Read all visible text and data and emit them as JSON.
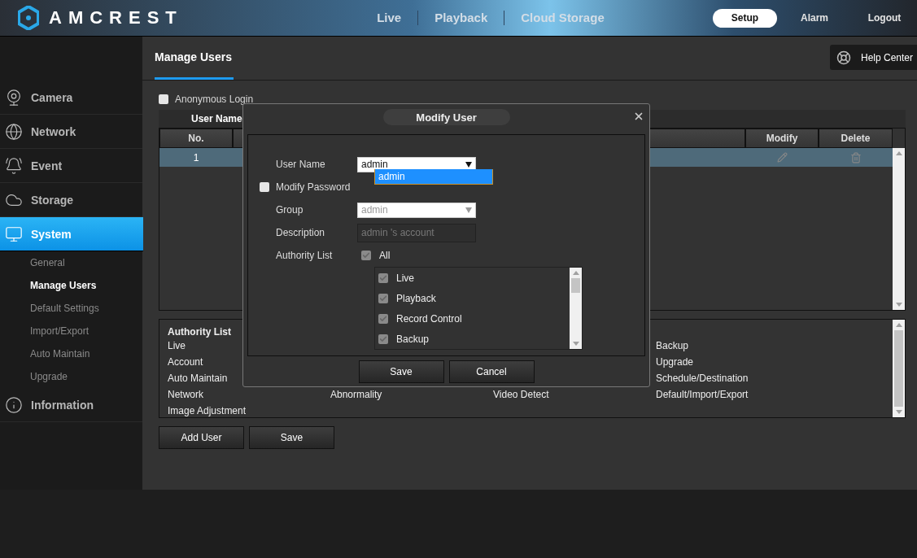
{
  "brand": {
    "name": "AMCREST"
  },
  "top_nav": [
    {
      "label": "Live",
      "selected": false
    },
    {
      "label": "Playback",
      "selected": false
    },
    {
      "label": "Cloud Storage",
      "selected": false
    }
  ],
  "top_actions": [
    {
      "label": "Setup",
      "selected": true
    },
    {
      "label": "Alarm",
      "selected": false
    },
    {
      "label": "Logout",
      "selected": false
    }
  ],
  "sidebar": {
    "items": [
      {
        "label": "Camera",
        "selected": false
      },
      {
        "label": "Network",
        "selected": false
      },
      {
        "label": "Event",
        "selected": false
      },
      {
        "label": "Storage",
        "selected": false
      },
      {
        "label": "System",
        "selected": true,
        "children": [
          {
            "label": "General",
            "selected": false
          },
          {
            "label": "Manage Users",
            "selected": true
          },
          {
            "label": "Default Settings",
            "selected": false
          },
          {
            "label": "Import/Export",
            "selected": false
          },
          {
            "label": "Auto Maintain",
            "selected": false
          },
          {
            "label": "Upgrade",
            "selected": false
          }
        ]
      },
      {
        "label": "Information",
        "selected": false
      }
    ]
  },
  "page": {
    "tab": "Manage Users",
    "help": "Help Center"
  },
  "anonymous_login": {
    "label": "Anonymous Login",
    "checked": false
  },
  "users_table": {
    "title": "User Name",
    "columns": [
      "No.",
      null,
      "Modify",
      "Delete"
    ],
    "rows": [
      {
        "no": "1",
        "selected": true
      }
    ]
  },
  "authority_panel": {
    "title": "Authority List",
    "rows": [
      [
        "Live",
        null,
        null,
        "Backup"
      ],
      [
        "Account",
        null,
        null,
        "Upgrade"
      ],
      [
        "Auto Maintain",
        null,
        null,
        "Schedule/Destination"
      ],
      [
        "Network",
        "Abnormality",
        "Video Detect",
        "Default/Import/Export"
      ],
      [
        "Image Adjustment",
        null,
        null,
        null
      ]
    ]
  },
  "buttons": [
    "Add User",
    "Save"
  ],
  "modal": {
    "title": "Modify User",
    "user_name": {
      "label": "User Name",
      "value": "admin",
      "options": [
        {
          "label": "admin",
          "selected": true
        }
      ]
    },
    "modify_password": {
      "label": "Modify Password",
      "checked": false
    },
    "group": {
      "label": "Group",
      "value": "admin",
      "disabled": true
    },
    "description": {
      "label": "Description",
      "value": "admin 's account",
      "disabled": true
    },
    "authority": {
      "label": "Authority List",
      "all": {
        "label": "All",
        "checked": true
      },
      "items": [
        {
          "label": "Live",
          "checked": true
        },
        {
          "label": "Playback",
          "checked": true
        },
        {
          "label": "Record Control",
          "checked": true
        },
        {
          "label": "Backup",
          "checked": true
        }
      ]
    },
    "buttons": [
      "Save",
      "Cancel"
    ]
  }
}
